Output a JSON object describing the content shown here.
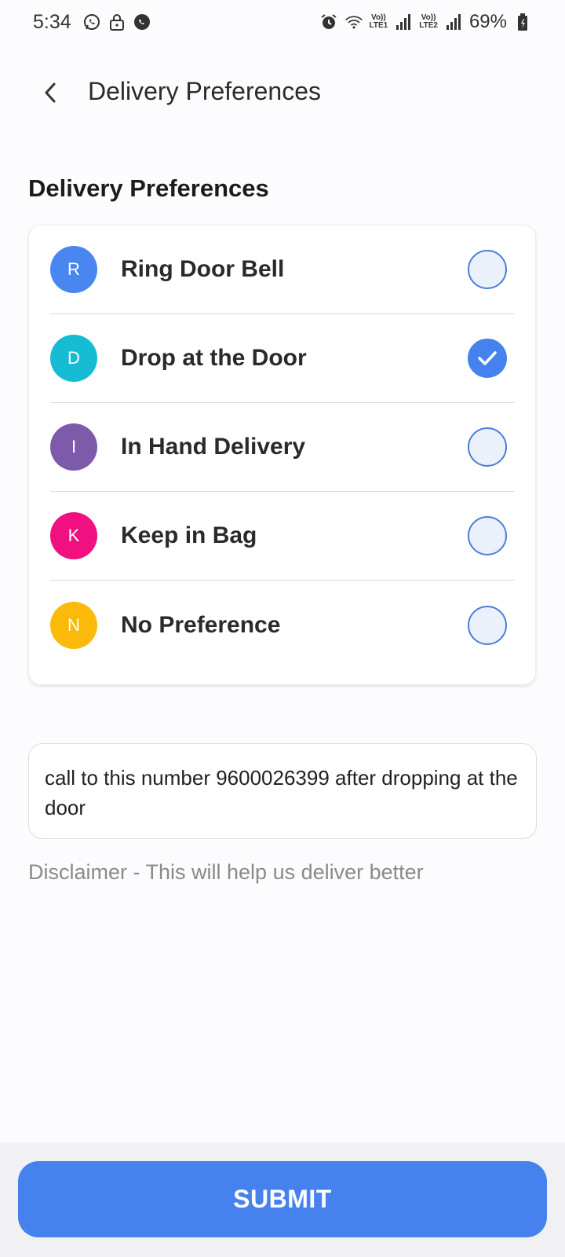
{
  "status_bar": {
    "time": "5:34",
    "icons": [
      "whatsapp-icon",
      "lock-icon",
      "chat-icon"
    ],
    "right_icons": [
      "alarm-icon",
      "wifi-icon",
      "signal-icon"
    ],
    "net1_top": "Vo))",
    "net1_bottom": "LTE1",
    "net2_top": "Vo))",
    "net2_bottom": "LTE2",
    "battery": "69%"
  },
  "header": {
    "title": "Delivery Preferences"
  },
  "section": {
    "title": "Delivery Preferences"
  },
  "options": [
    {
      "initial": "R",
      "label": "Ring Door Bell",
      "color": "#4A86F0",
      "selected": false
    },
    {
      "initial": "D",
      "label": "Drop at the Door",
      "color": "#16BCD4",
      "selected": true
    },
    {
      "initial": "I",
      "label": "In Hand Delivery",
      "color": "#7E5BAA",
      "selected": false
    },
    {
      "initial": "K",
      "label": "Keep in Bag",
      "color": "#F0107F",
      "selected": false
    },
    {
      "initial": "N",
      "label": "No Preference",
      "color": "#FBBA0A",
      "selected": false
    }
  ],
  "note": {
    "value": "call to this number 9600026399 after dropping at the door"
  },
  "disclaimer": "Disclaimer - This will help us deliver better",
  "submit_label": "SUBMIT",
  "colors": {
    "accent": "#4582EE",
    "radio_border": "#4A7FD6",
    "radio_fill": "#EAF1FB"
  }
}
